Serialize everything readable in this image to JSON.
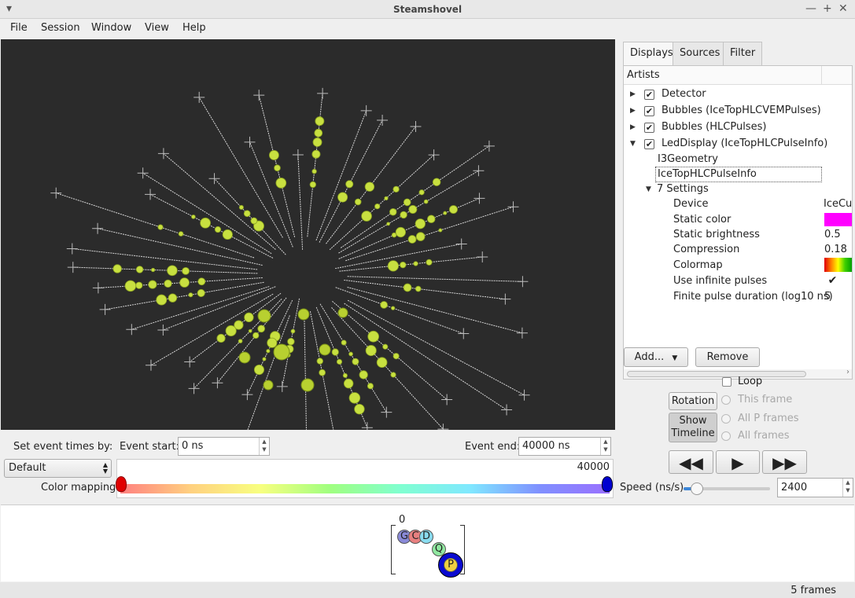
{
  "window": {
    "title": "Steamshovel"
  },
  "menu": [
    {
      "label": "File"
    },
    {
      "label": "Session"
    },
    {
      "label": "Window"
    },
    {
      "label": "View"
    },
    {
      "label": "Help"
    }
  ],
  "tabs": [
    "Displays",
    "Sources",
    "Filter"
  ],
  "artists_header": "Artists",
  "artists": [
    {
      "label": "Detector",
      "checked": true
    },
    {
      "label": "Bubbles (IceTopHLCVEMPulses)",
      "checked": true
    },
    {
      "label": "Bubbles (HLCPulses)",
      "checked": true
    },
    {
      "label": "LedDisplay (IceTopHLCPulseInfo)",
      "checked": true
    }
  ],
  "led_children": [
    "I3Geometry",
    "IceTopHLCPulseInfo"
  ],
  "settings_label": "7 Settings",
  "settings": [
    {
      "name": "Device",
      "value": "IceCul"
    },
    {
      "name": "Static color",
      "value": "",
      "color": "#ff00ff"
    },
    {
      "name": "Static brightness",
      "value": "0.5"
    },
    {
      "name": "Compression",
      "value": "0.18"
    },
    {
      "name": "Colormap",
      "value": ""
    },
    {
      "name": "Use infinite pulses",
      "value": "✔"
    },
    {
      "name": "Finite pulse duration (log10 ns)",
      "value": "5"
    }
  ],
  "buttons": {
    "add": "Add...",
    "remove": "Remove",
    "rotation": "Rotation",
    "show_timeline": "Show\nTimeline"
  },
  "loop_label": "Loop",
  "frame_options": [
    "This frame",
    "All P frames",
    "All frames"
  ],
  "event": {
    "set_times_label": "Set event times by:",
    "start_label": "Event start:",
    "start_value": "0 ns",
    "end_label": "Event end:",
    "end_value": "40000 ns",
    "mode": "Default",
    "color_mapping_label": "Color mapping:",
    "range_max": "40000"
  },
  "speed": {
    "label": "Speed (ns/s)",
    "value": "2400"
  },
  "timeline": {
    "frame_index": "0",
    "frames": [
      "G",
      "C",
      "D",
      "Q",
      "P"
    ]
  },
  "status": {
    "frames": "5 frames"
  }
}
